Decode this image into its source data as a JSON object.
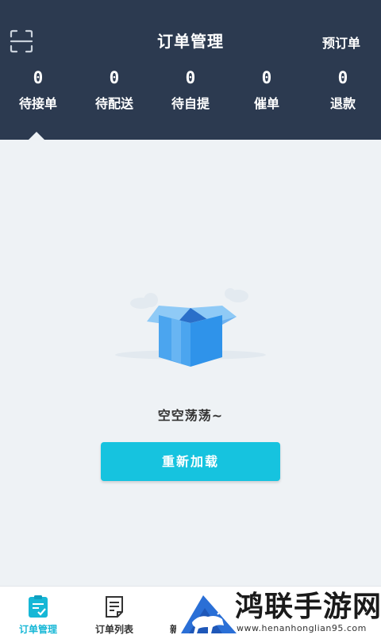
{
  "header": {
    "title": "订单管理",
    "right_action": "预订单",
    "scan_icon": "scan-icon"
  },
  "stats": [
    {
      "count": "0",
      "label": "待接单"
    },
    {
      "count": "0",
      "label": "待配送"
    },
    {
      "count": "0",
      "label": "待自提"
    },
    {
      "count": "0",
      "label": "催单"
    },
    {
      "count": "0",
      "label": "退款"
    }
  ],
  "empty": {
    "icon": "empty-box-icon",
    "text": "空空荡荡~",
    "reload_label": "重新加载"
  },
  "tabbar": {
    "items": [
      {
        "label": "订单管理",
        "icon": "order-manage-icon",
        "active": true
      },
      {
        "label": "订单列表",
        "icon": "order-list-icon",
        "active": false
      },
      {
        "label": "新",
        "icon": "new-icon",
        "active": false
      }
    ]
  },
  "watermark": {
    "title": "鸿联手游网",
    "url": "www.henanhonglian95.com"
  },
  "colors": {
    "header_bg": "#2c3a50",
    "page_bg": "#eef2f5",
    "accent": "#16c3df",
    "tab_active": "#16b7d6"
  }
}
